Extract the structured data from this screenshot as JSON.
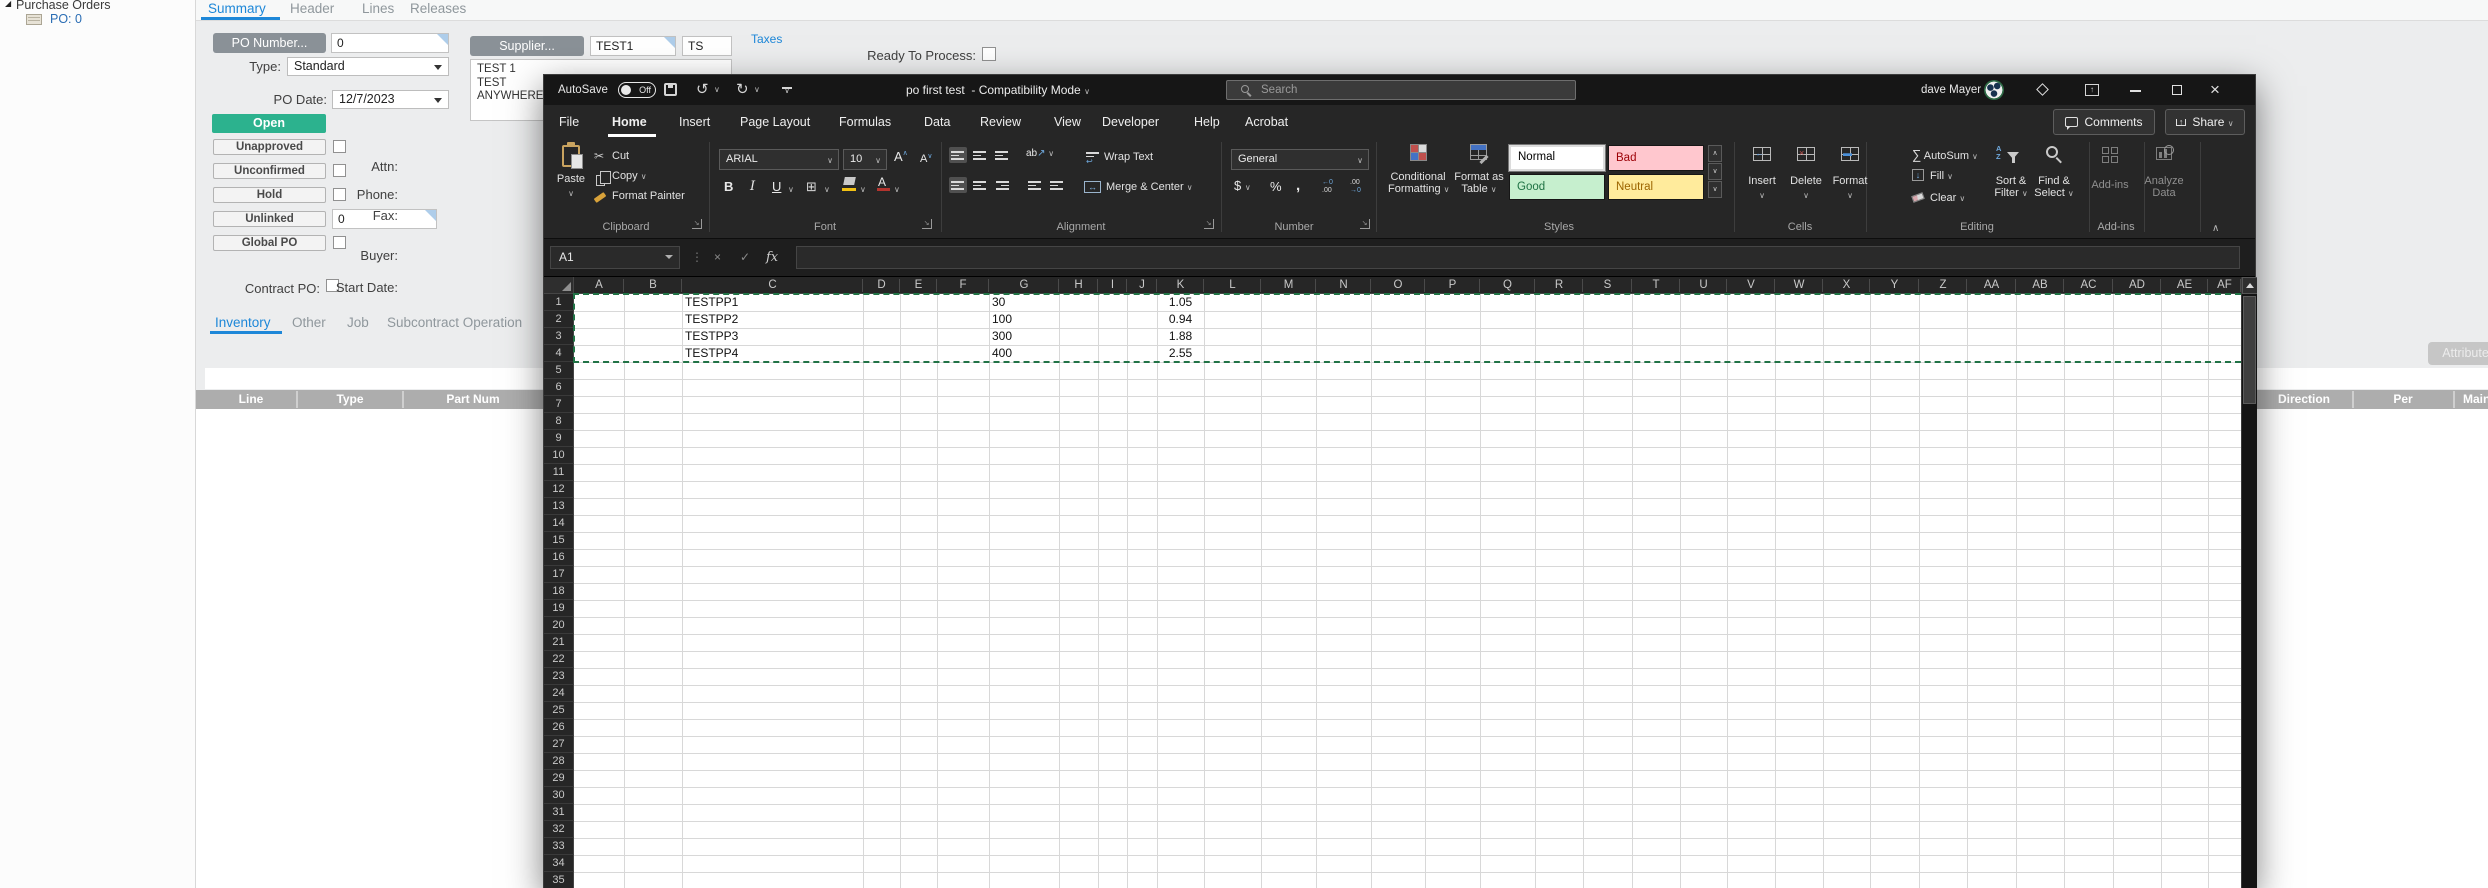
{
  "erp": {
    "tree": {
      "root": "Purchase Orders",
      "child": "PO: 0"
    },
    "tabs": [
      "Summary",
      "Header",
      "Lines",
      "Releases"
    ],
    "active_tab": "Summary",
    "form": {
      "po_number_button": "PO Number...",
      "po_number_value": "0",
      "type_label": "Type:",
      "type_value": "Standard",
      "po_date_label": "PO Date:",
      "po_date_value": "12/7/2023",
      "open_button": "Open",
      "status_buttons": [
        "Unapproved",
        "Unconfirmed",
        "Hold",
        "Unlinked",
        "Global PO"
      ],
      "unlinked_value": "0",
      "contract_po_label": "Contract PO:",
      "supplier_button": "Supplier...",
      "supplier_code": "TEST1",
      "supplier_short": "TS",
      "supplier_address": [
        "TEST 1",
        "TEST",
        "ANYWHERE, I"
      ],
      "detail_labels": [
        "Attn:",
        "Phone:",
        "Fax:",
        "Buyer:",
        "Start Date:"
      ],
      "taxes_link": "Taxes",
      "ready_to_process_label": "Ready To Process:"
    },
    "lower_tabs": [
      "Inventory",
      "Other",
      "Job",
      "Subcontract Operation"
    ],
    "active_lower_tab": "Inventory",
    "grid_headers_left": [
      "Line",
      "Type",
      "Part Num"
    ],
    "grid_headers_right": [
      "Direction",
      "Per",
      "Maint"
    ],
    "attribute_button": "Attribute"
  },
  "excel": {
    "titlebar": {
      "autosave_label": "AutoSave",
      "autosave_state": "Off",
      "document_title": "po first test",
      "mode_suffix": "- Compatibility Mode",
      "search_placeholder": "Search",
      "user_name": "dave Mayer"
    },
    "menu_tabs": [
      "File",
      "Home",
      "Insert",
      "Page Layout",
      "Formulas",
      "Data",
      "Review",
      "View",
      "Developer",
      "Help",
      "Acrobat"
    ],
    "active_menu_tab": "Home",
    "comments_button": "Comments",
    "share_button": "Share",
    "ribbon": {
      "clipboard": {
        "group": "Clipboard",
        "paste": "Paste",
        "cut": "Cut",
        "copy": "Copy",
        "format_painter": "Format Painter"
      },
      "font": {
        "group": "Font",
        "font_name": "ARIAL",
        "font_size": "10"
      },
      "alignment": {
        "group": "Alignment",
        "wrap_text": "Wrap Text",
        "merge_center": "Merge & Center"
      },
      "number": {
        "group": "Number",
        "number_format": "General"
      },
      "styles": {
        "group": "Styles",
        "conditional_line1": "Conditional",
        "conditional_line2": "Formatting",
        "format_table_line1": "Format as",
        "format_table_line2": "Table",
        "cell_styles": [
          "Normal",
          "Bad",
          "Good",
          "Neutral"
        ]
      },
      "cells": {
        "group": "Cells",
        "buttons": [
          "Insert",
          "Delete",
          "Format"
        ]
      },
      "editing": {
        "group": "Editing",
        "autosum": "AutoSum",
        "fill": "Fill",
        "clear": "Clear",
        "sort_line1": "Sort &",
        "sort_line2": "Filter",
        "find_line1": "Find &",
        "find_line2": "Select"
      },
      "addins": {
        "group": "Add-ins",
        "addins_button": "Add-ins",
        "analyze_line1": "Analyze",
        "analyze_line2": "Data"
      }
    },
    "formula_bar": {
      "name_box": "A1",
      "fx": "fx"
    },
    "sheet": {
      "columns": [
        "A",
        "B",
        "C",
        "D",
        "E",
        "F",
        "G",
        "H",
        "I",
        "J",
        "K",
        "L",
        "M",
        "N",
        "O",
        "P",
        "Q",
        "R",
        "S",
        "T",
        "U",
        "V",
        "W",
        "X",
        "Y",
        "Z",
        "AA",
        "AB",
        "AC",
        "AD",
        "AE",
        "AF"
      ],
      "visible_rows": 35,
      "cells": [
        {
          "row": 1,
          "col": "C",
          "value": "TESTPP1",
          "align": "left"
        },
        {
          "row": 1,
          "col": "G",
          "value": "30",
          "align": "left"
        },
        {
          "row": 1,
          "col": "K",
          "value": "1.05",
          "align": "center"
        },
        {
          "row": 2,
          "col": "C",
          "value": "TESTPP2",
          "align": "left"
        },
        {
          "row": 2,
          "col": "G",
          "value": "100",
          "align": "left"
        },
        {
          "row": 2,
          "col": "K",
          "value": "0.94",
          "align": "center"
        },
        {
          "row": 3,
          "col": "C",
          "value": "TESTPP3",
          "align": "left"
        },
        {
          "row": 3,
          "col": "G",
          "value": "300",
          "align": "left"
        },
        {
          "row": 3,
          "col": "K",
          "value": "1.88",
          "align": "center"
        },
        {
          "row": 4,
          "col": "C",
          "value": "TESTPP4",
          "align": "left"
        },
        {
          "row": 4,
          "col": "G",
          "value": "400",
          "align": "left"
        },
        {
          "row": 4,
          "col": "K",
          "value": "2.55",
          "align": "center"
        }
      ],
      "marquee_rows": "1:4"
    }
  }
}
